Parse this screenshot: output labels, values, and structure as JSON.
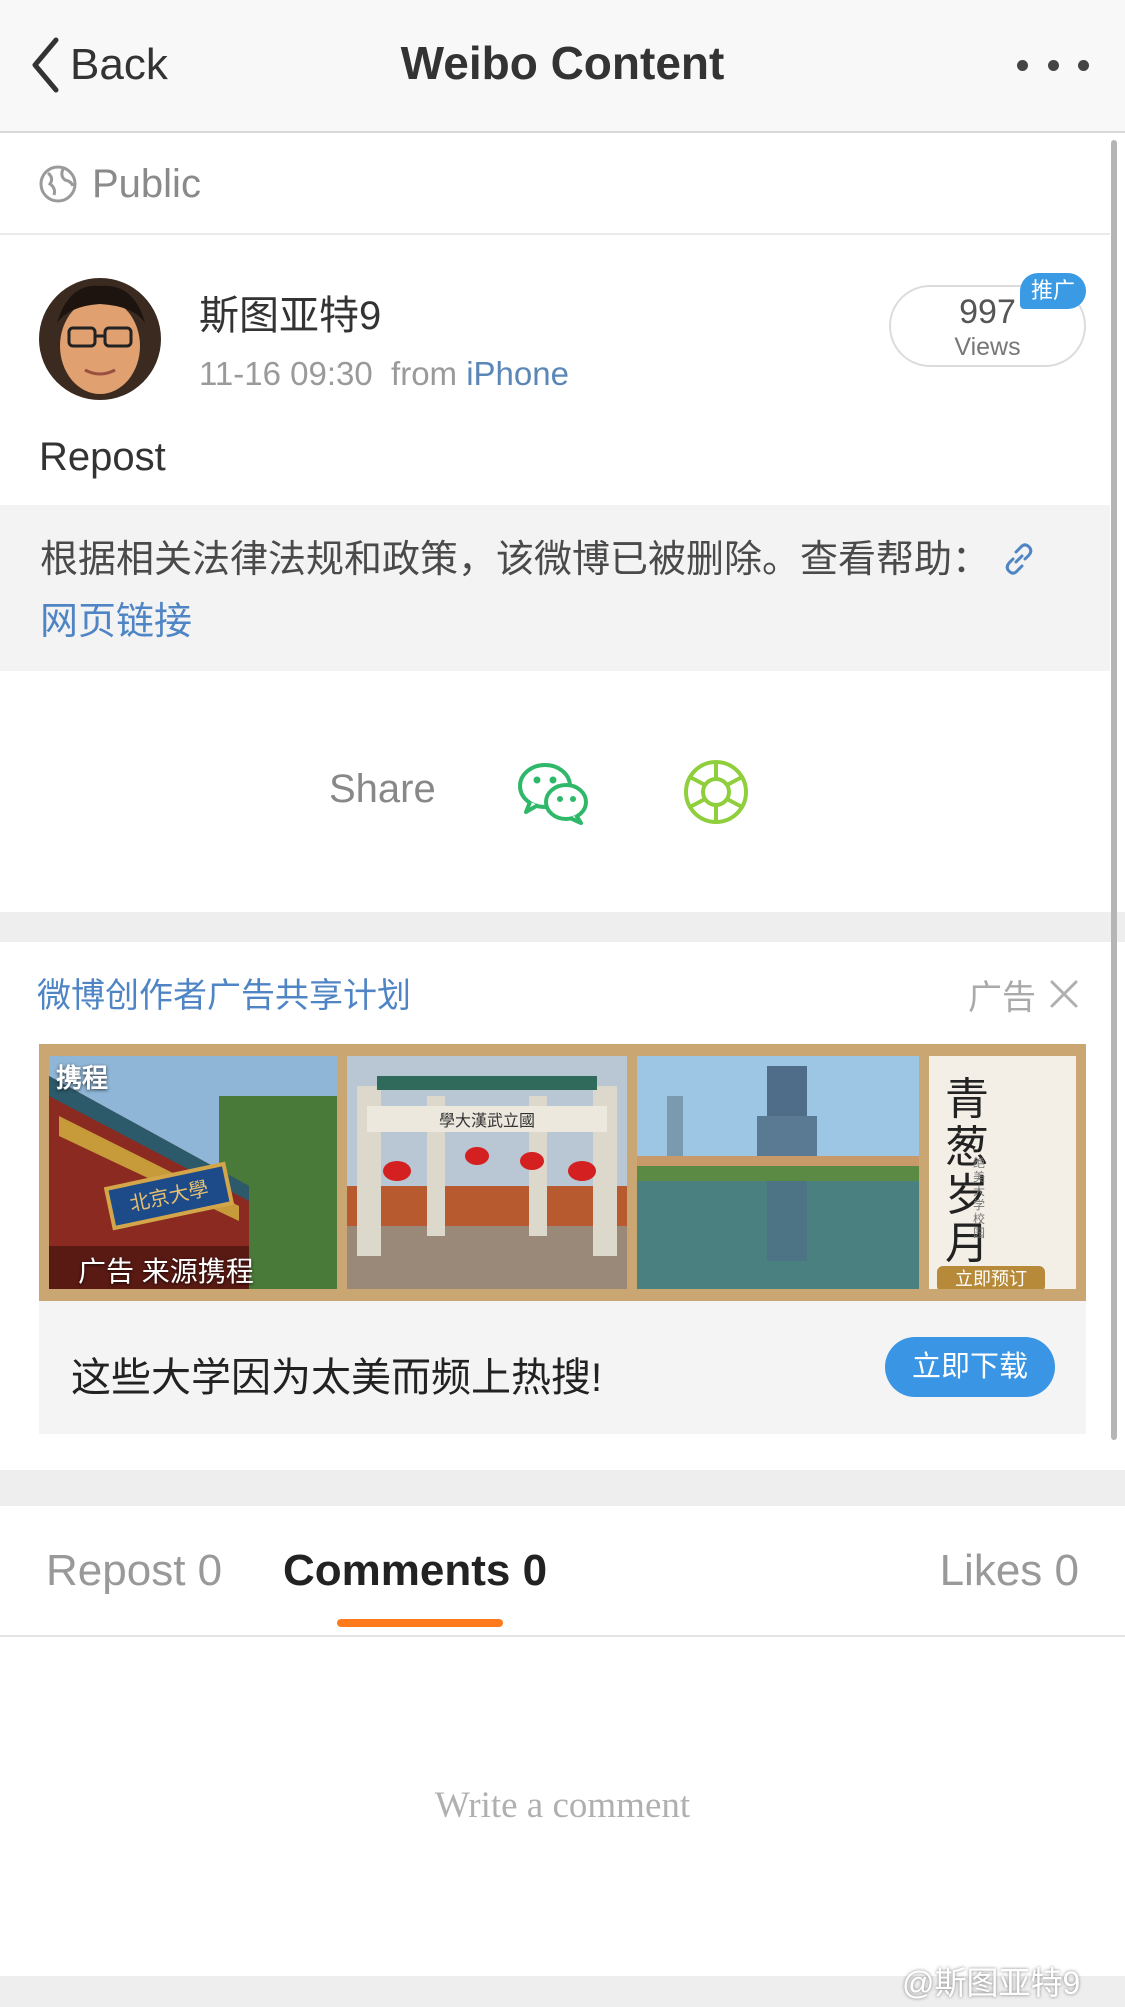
{
  "nav": {
    "back_label": "Back",
    "title": "Weibo Content"
  },
  "visibility": {
    "label": "Public"
  },
  "post": {
    "username": "斯图亚特9",
    "time": "11-16 09:30",
    "from_label": "from",
    "source": "iPhone",
    "views_count": "997",
    "views_label": "Views",
    "promo_badge": "推广",
    "text": "Repost",
    "deleted_notice": "根据相关法律法规和政策，该微博已被删除。查看帮助：",
    "deleted_link": "网页链接"
  },
  "share": {
    "label": "Share"
  },
  "ad": {
    "title": "微博创作者广告共享计划",
    "tag": "广告",
    "logo": "携程",
    "source": "广告 来源携程",
    "panel_text": "青葱岁月",
    "panel_small": "绝美大学校园",
    "panel_button": "立即预订",
    "gate_text": "學大漢武立國",
    "plaque_text": "北京大學",
    "caption": "这些大学因为太美而频上热搜!",
    "download_label": "立即下载"
  },
  "tabs": {
    "repost": "Repost 0",
    "comments": "Comments 0",
    "likes": "Likes 0"
  },
  "comment": {
    "placeholder": "Write a comment"
  },
  "watermark": "@斯图亚特9",
  "colors": {
    "link_blue": "#4f85c4",
    "tab_underline": "#ff7a1c",
    "wechat_green": "#2fb86a",
    "moments_green": "#8fcf3c",
    "download_blue": "#3a95e4"
  }
}
